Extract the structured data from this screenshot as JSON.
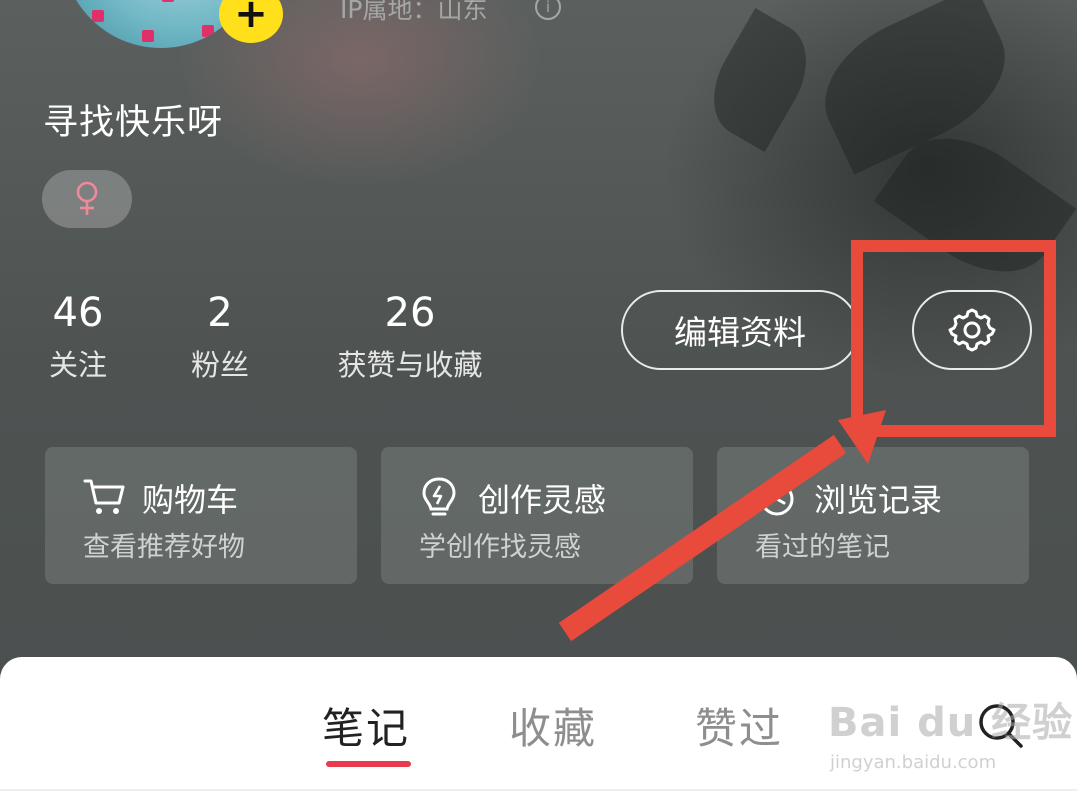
{
  "profile": {
    "add_symbol": "+",
    "ip_location": "IP属地：山东",
    "info_symbol": "i",
    "nickname": "寻找快乐呀",
    "gender_symbol": "♀"
  },
  "stats": [
    {
      "value": "46",
      "label": "关注"
    },
    {
      "value": "2",
      "label": "粉丝"
    },
    {
      "value": "26",
      "label": "获赞与收藏"
    }
  ],
  "actions": {
    "edit_label": "编辑资料",
    "settings_icon": "gear-icon"
  },
  "cards": [
    {
      "icon": "cart-icon",
      "title": "购物车",
      "subtitle": "查看推荐好物"
    },
    {
      "icon": "lightbulb-icon",
      "title": "创作灵感",
      "subtitle": "学创作找灵感"
    },
    {
      "icon": "history-icon",
      "title": "浏览记录",
      "subtitle": "看过的笔记"
    }
  ],
  "tabs": [
    {
      "label": "笔记",
      "active": true
    },
    {
      "label": "收藏",
      "active": false
    },
    {
      "label": "赞过",
      "active": false
    }
  ],
  "watermark": {
    "brand": "Bai  du 经验",
    "url": "jingyan.baidu.com"
  },
  "colors": {
    "annotation_red": "#e84a3c",
    "tab_underline": "#e83b4e",
    "add_button": "#ffe01a",
    "gender_pink": "#f08a9a"
  }
}
